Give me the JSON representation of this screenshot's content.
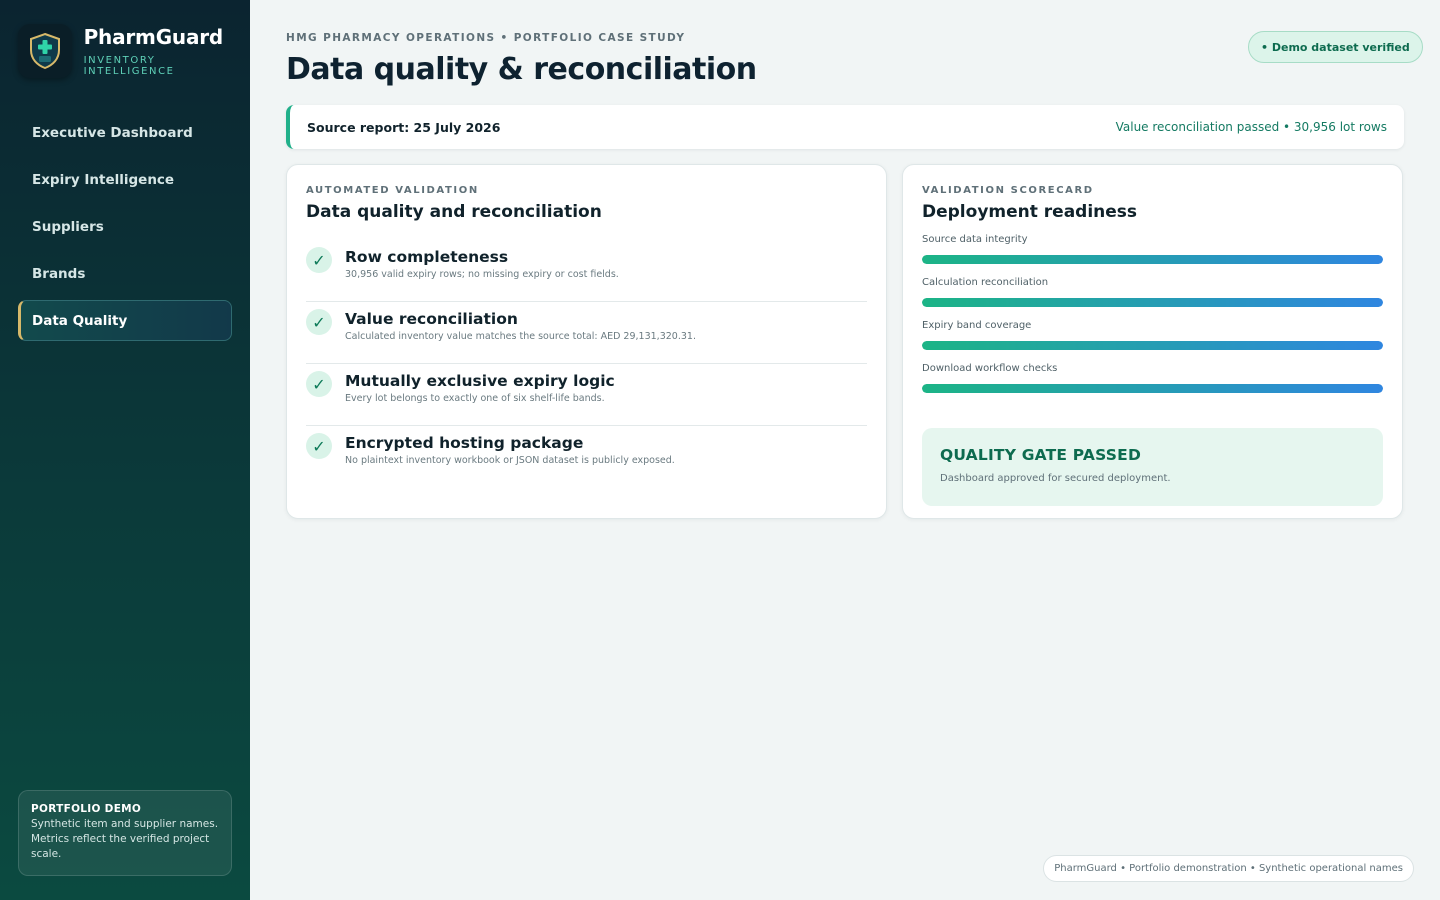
{
  "brand": {
    "name": "PharmGuard",
    "tagline": "INVENTORY INTELLIGENCE",
    "logo_icon": "shield-cross-icon"
  },
  "sidebar": {
    "items": [
      {
        "label": "Executive Dashboard",
        "active": false
      },
      {
        "label": "Expiry Intelligence",
        "active": false
      },
      {
        "label": "Suppliers",
        "active": false
      },
      {
        "label": "Brands",
        "active": false
      },
      {
        "label": "Data Quality",
        "active": true
      }
    ],
    "demo": {
      "title": "PORTFOLIO DEMO",
      "text": "Synthetic item and supplier names. Metrics reflect the verified project scale."
    }
  },
  "header": {
    "eyebrow": "HMG PHARMACY OPERATIONS • PORTFOLIO CASE STUDY",
    "title": "Data quality & reconciliation",
    "badge": "• Demo dataset verified"
  },
  "source_bar": {
    "label": "Source report: 25 July 2026",
    "status": "Value reconciliation passed • 30,956 lot rows"
  },
  "validation": {
    "eyebrow": "AUTOMATED VALIDATION",
    "title": "Data quality and reconciliation",
    "checks": [
      {
        "title": "Row completeness",
        "desc": "30,956 valid expiry rows; no missing expiry or cost fields.",
        "icon": "check-icon"
      },
      {
        "title": "Value reconciliation",
        "desc": "Calculated inventory value matches the source total: AED 29,131,320.31.",
        "icon": "check-icon"
      },
      {
        "title": "Mutually exclusive expiry logic",
        "desc": "Every lot belongs to exactly one of six shelf-life bands.",
        "icon": "check-icon"
      },
      {
        "title": "Encrypted hosting package",
        "desc": "No plaintext inventory workbook or JSON dataset is publicly exposed.",
        "icon": "check-icon"
      }
    ]
  },
  "scorecard": {
    "eyebrow": "VALIDATION SCORECARD",
    "title": "Deployment readiness",
    "metrics": [
      {
        "label": "Source data integrity",
        "value": 100
      },
      {
        "label": "Calculation reconciliation",
        "value": 100
      },
      {
        "label": "Expiry band coverage",
        "value": 100
      },
      {
        "label": "Download workflow checks",
        "value": 100
      }
    ],
    "gate": {
      "title": "QUALITY GATE PASSED",
      "text": "Dashboard approved for secured deployment."
    }
  },
  "footer": {
    "text": "PharmGuard • Portfolio demonstration • Synthetic operational names"
  },
  "colors": {
    "accent": "#21b08a",
    "bar_start": "#1cb486",
    "bar_end": "#2f86e0",
    "nav_active_border": "#d7b96a"
  }
}
